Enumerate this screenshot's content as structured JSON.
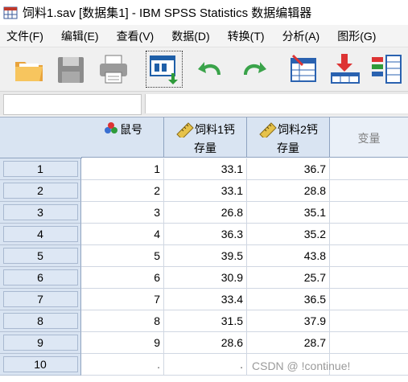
{
  "window": {
    "title": "饲料1.sav [数据集1] - IBM SPSS Statistics 数据编辑器"
  },
  "menu": [
    "文件(F)",
    "编辑(E)",
    "查看(V)",
    "数据(D)",
    "转换(T)",
    "分析(A)",
    "图形(G)"
  ],
  "toolbar": [
    {
      "name": "open-folder-icon"
    },
    {
      "name": "save-disk-icon"
    },
    {
      "name": "print-icon"
    },
    {
      "name": "recall-dialog-icon"
    },
    {
      "name": "undo-icon"
    },
    {
      "name": "redo-icon"
    },
    {
      "name": "goto-case-icon"
    },
    {
      "name": "goto-variable-icon"
    },
    {
      "name": "variables-icon"
    }
  ],
  "cellref": {
    "name": "",
    "value": ""
  },
  "grid": {
    "columns": [
      {
        "line1": "鼠号",
        "line2": "",
        "icon": "nominal-icon"
      },
      {
        "line1": "饲料1钙",
        "line2": "存量",
        "icon": "scale-icon"
      },
      {
        "line1": "饲料2钙",
        "line2": "存量",
        "icon": "scale-icon"
      },
      {
        "line1": "变量",
        "line2": "",
        "icon": ""
      }
    ],
    "rows": [
      {
        "n": "1",
        "c1": "1",
        "c2": "33.1",
        "c3": "36.7"
      },
      {
        "n": "2",
        "c1": "2",
        "c2": "33.1",
        "c3": "28.8"
      },
      {
        "n": "3",
        "c1": "3",
        "c2": "26.8",
        "c3": "35.1"
      },
      {
        "n": "4",
        "c1": "4",
        "c2": "36.3",
        "c3": "35.2"
      },
      {
        "n": "5",
        "c1": "5",
        "c2": "39.5",
        "c3": "43.8"
      },
      {
        "n": "6",
        "c1": "6",
        "c2": "30.9",
        "c3": "25.7"
      },
      {
        "n": "7",
        "c1": "7",
        "c2": "33.4",
        "c3": "36.5"
      },
      {
        "n": "8",
        "c1": "8",
        "c2": "31.5",
        "c3": "37.9"
      },
      {
        "n": "9",
        "c1": "9",
        "c2": "28.6",
        "c3": "28.7"
      },
      {
        "n": "10",
        "c1": ".",
        "c2": ".",
        "c3": "."
      }
    ]
  },
  "watermark": "CSDN @ !continue!"
}
